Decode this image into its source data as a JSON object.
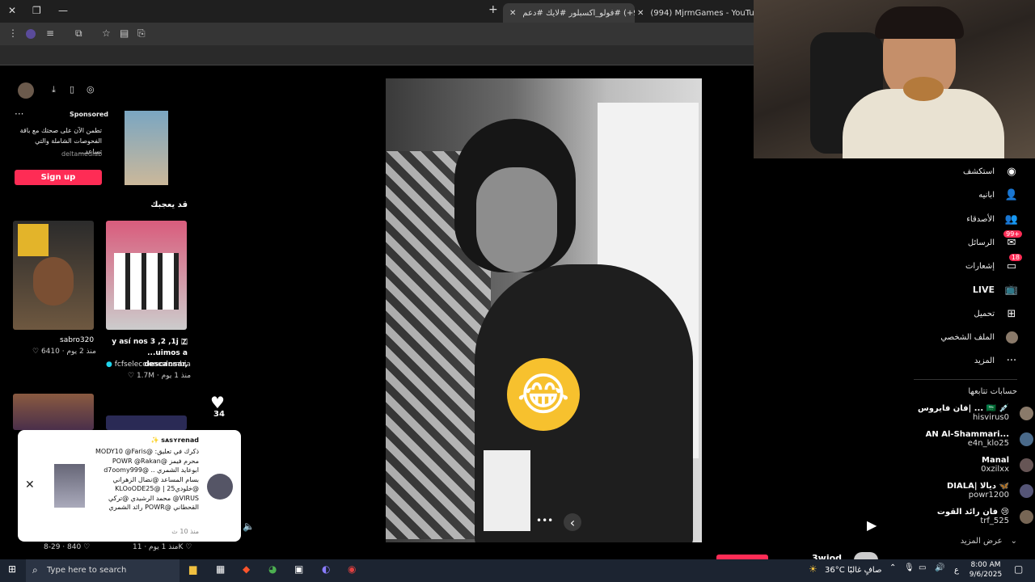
{
  "browser": {
    "tabs": [
      {
        "label": "(99+) #فولو_اكسبلور #لايك #دعم",
        "active": true
      },
      {
        "label": "(994) MjrmGames - YouTube",
        "active": false
      }
    ],
    "new_tab_icon": "+",
    "close_icon": "✕"
  },
  "sidebar_left": {
    "sponsored_label": "Sponsored",
    "ad_text": "تطمن الآن على صحتك مع باقة الفحوصات الشاملة والتي تساعد...",
    "ad_advertiser": "deltamedlab",
    "signup_label": "Sign up",
    "you_may_like": "قد يعجبك",
    "videos": [
      {
        "author": "sabro320",
        "likes": "6410",
        "date": "منذ 2 يوم"
      },
      {
        "caption": "y así nos 3 ,2 ,1j 🇿 ...uimos a descansar,",
        "author": "fcfseleccioncolombia",
        "likes": "1.7M",
        "date": "منذ 1 يوم"
      }
    ],
    "bottom_row": [
      {
        "likes": "840",
        "date": "8-29"
      },
      {
        "likes": "11K",
        "date": "منذ 1 يوم"
      }
    ]
  },
  "notification": {
    "title": "✨ sᴀsʏrenad",
    "body": "ذكرك في تعليق: @MODY10 @Faris محرم فيمز @POWR @Rakan ابوعايد الشمري .. @d7oomy999 بسام المساعد @نضال الزهراني @خلودي25 | @KLOoODE25 @VIRUS محمد الرشيدي @تركي القحطاني @POWR رائد الشمري",
    "time": "منذ 10 ث"
  },
  "video_actions": {
    "likes": "34"
  },
  "right_nav": {
    "items": [
      {
        "label": "استكشف"
      },
      {
        "label": "ابانيه"
      },
      {
        "label": "الأصدقاء"
      },
      {
        "label": "الرسائل",
        "badge": "99+"
      },
      {
        "label": "إشعارات",
        "badge": "18"
      },
      {
        "label": "LIVE"
      },
      {
        "label": "تحميل"
      },
      {
        "label": "الملف الشخصي"
      },
      {
        "label": "المزيد"
      }
    ],
    "following_title": "حسابات تتابعها",
    "following": [
      {
        "name": "فان فايروس| ... 🇸🇦 💉",
        "handle": "hisvirus0"
      },
      {
        "name": "AN Al-Shammari...",
        "handle": "e4n_klo25"
      },
      {
        "name": "Manal",
        "handle": "0xzilxx"
      },
      {
        "name": "DIALA| ديالا 🦋",
        "handle": "powr1200"
      },
      {
        "name": "فان رائد القوت 😢",
        "handle": "trf_525"
      }
    ],
    "show_more": "عرض المزيد"
  },
  "video_controls": {
    "more_dots": "•••",
    "prev_icon": "‹"
  },
  "taskbar": {
    "search_placeholder": "Type here to search",
    "weather": "36°C",
    "weather_text": "صافٍ غالبًا",
    "time": "8:00 AM",
    "date": "9/6/2025",
    "lang": "ع"
  },
  "bottom_peek": {
    "name": "3wiod"
  },
  "colors": {
    "tiktok_red": "#fe2c55",
    "taskbar": "#1c2431"
  }
}
